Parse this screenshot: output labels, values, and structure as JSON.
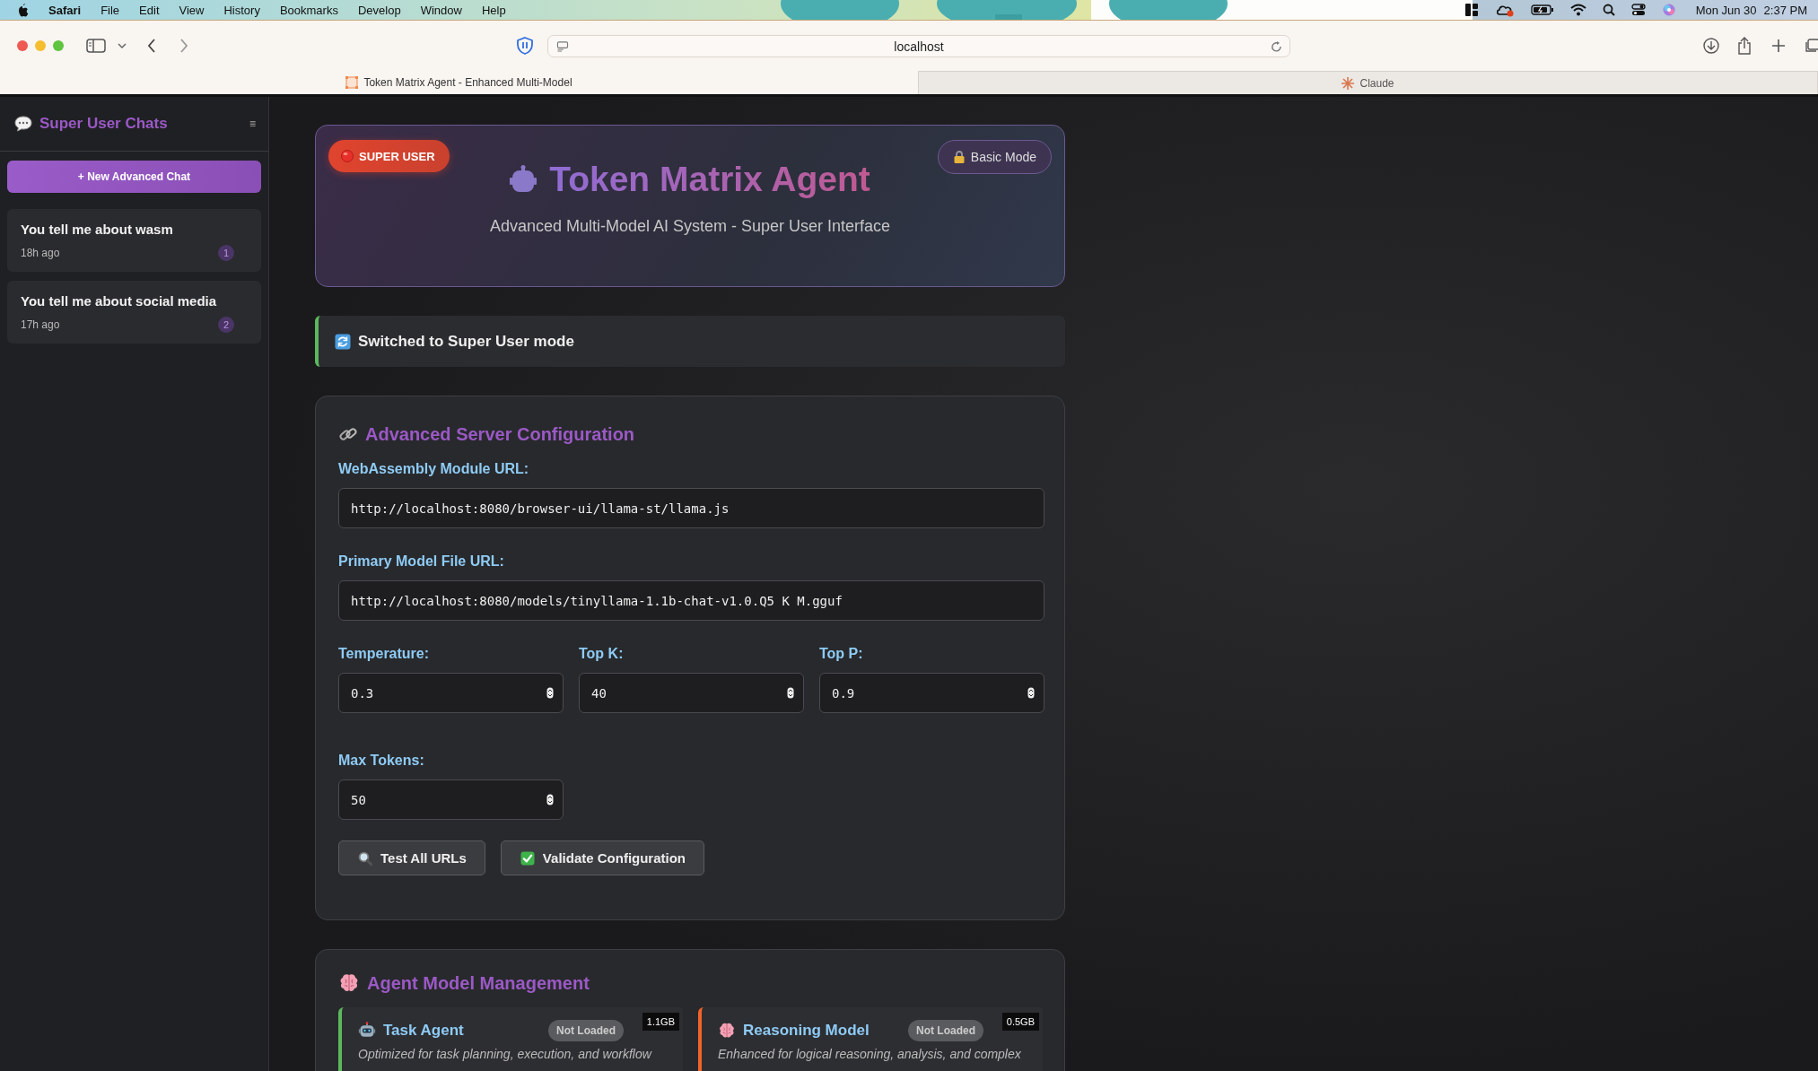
{
  "menu_bar": {
    "app": "Safari",
    "menus": [
      "File",
      "Edit",
      "View",
      "History",
      "Bookmarks",
      "Develop",
      "Window",
      "Help"
    ],
    "date": "Mon Jun 30",
    "time": "2:37 PM"
  },
  "browser": {
    "address": "localhost",
    "tabs": [
      {
        "title": "Token Matrix Agent - Enhanced Multi-Model",
        "selected": true
      },
      {
        "title": "Claude",
        "selected": false
      }
    ]
  },
  "sidebar": {
    "title": "Super User Chats",
    "menu_glyph": "≡",
    "new_chat": "+ New Advanced Chat",
    "chats": [
      {
        "title": "You tell me about wasm",
        "time": "18h ago",
        "count": "1"
      },
      {
        "title": "You tell me about social media",
        "time": "17h ago",
        "count": "2"
      }
    ]
  },
  "header": {
    "badge": "SUPER USER",
    "mode_button": "Basic Mode",
    "title": "Token Matrix Agent",
    "subtitle": "Advanced Multi-Model AI System - Super User Interface"
  },
  "notice": "Switched to Super User mode",
  "config": {
    "title": "Advanced Server Configuration",
    "fields": [
      {
        "label": "WebAssembly Module URL:",
        "value": "http://localhost:8080/browser-ui/llama-st/llama.js",
        "kind": "text"
      },
      {
        "label": "Primary Model File URL:",
        "value": "http://localhost:8080/models/tinyllama-1.1b-chat-v1.0.Q5_K_M.gguf",
        "kind": "text"
      },
      {
        "label": "Temperature:",
        "value": "0.3",
        "kind": "number"
      },
      {
        "label": "Top K:",
        "value": "40",
        "kind": "number"
      },
      {
        "label": "Top P:",
        "value": "0.9",
        "kind": "number"
      },
      {
        "label": "Max Tokens:",
        "value": "50",
        "kind": "number"
      }
    ],
    "buttons": [
      {
        "label": "Test All URLs",
        "kind": "search"
      },
      {
        "label": "Validate Configuration",
        "kind": "check"
      }
    ]
  },
  "models": {
    "title": "Agent Model Management",
    "cards": [
      {
        "name": "Task Agent",
        "kind": "robot",
        "status": "Not Loaded",
        "size": "1.1GB",
        "description": "Optimized for task planning, execution, and workflow",
        "color": "#5cb85c"
      },
      {
        "name": "Reasoning Model",
        "kind": "brain",
        "status": "Not Loaded",
        "size": "0.5GB",
        "description": "Enhanced for logical reasoning, analysis, and complex",
        "color": "#f0642a"
      }
    ]
  }
}
